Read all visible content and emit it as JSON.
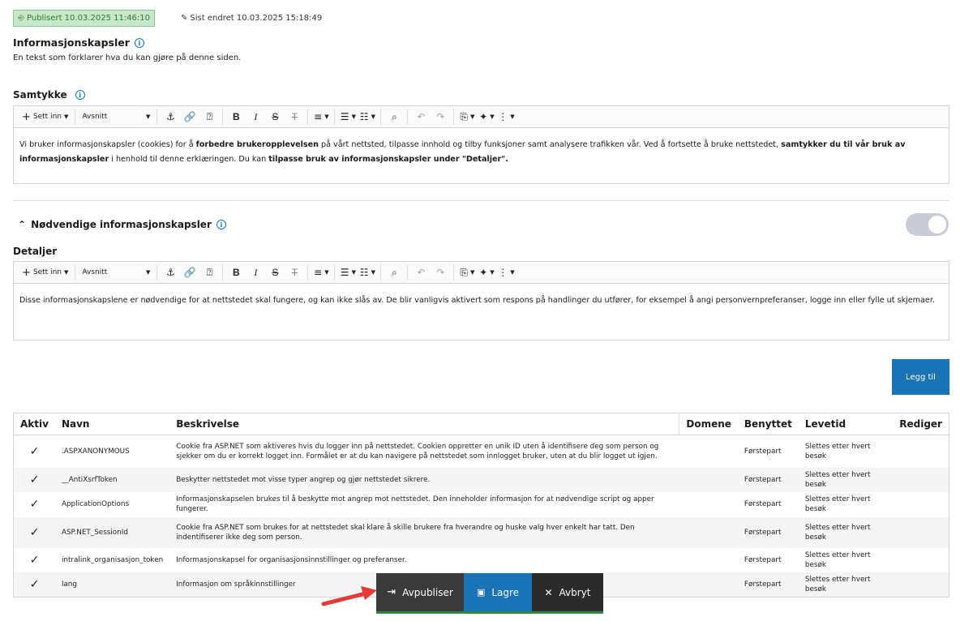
{
  "status": {
    "published": "Publisert 10.03.2025 11:46:10",
    "edited": "Sist endret 10.03.2025 15:18:49"
  },
  "page": {
    "title": "Informasjonskapsler",
    "description": "En tekst som forklarer hva du kan gjøre på denne siden."
  },
  "toolbar": {
    "insert": "Sett inn",
    "format": "Avsnitt"
  },
  "consent": {
    "label": "Samtykke",
    "text_1": "Vi bruker informasjonskapsler (cookies) for å ",
    "bold_1": "forbedre brukeropplevelsen",
    "text_2": " på vårt nettsted, tilpasse innhold og tilby funksjoner samt analysere trafikken vår. Ved å fortsette å bruke nettstedet, ",
    "bold_2": "samtykker du til vår bruk av informasjonskapsler",
    "text_3": " i henhold til denne erklæringen.  Du kan ",
    "bold_3": "tilpasse bruk av informasjonskapsler under \"Detaljer\"."
  },
  "necessary": {
    "title": "Nødvendige informasjonskapsler",
    "toggle_on": true,
    "details_label": "Detaljer",
    "details_text": "Disse informasjonskapslene er nødvendige for at nettstedet skal fungere, og kan ikke slås av. De blir vanligvis aktivert som respons på handlinger du utfører, for eksempel å angi personvernpreferanser, logge inn eller fylle ut skjemaer."
  },
  "add_button": "Legg til",
  "table": {
    "headers": [
      "Aktiv",
      "Navn",
      "Beskrivelse",
      "Domene",
      "Benyttet",
      "Levetid",
      "Rediger"
    ],
    "rows": [
      {
        "active": "✓",
        "name": ".ASPXANONYMOUS",
        "description": "Cookie fra ASP.NET som aktiveres hvis du logger inn på nettstedet. Cookien oppretter en unik ID uten å identifisere deg som person og sjekker om du er korrekt logget inn. Formålet er at du kan navigere på nettstedet som innlogget bruker, uten at du blir logget ut igjen.",
        "domain": "",
        "used": "Førstepart",
        "lifetime": "Slettes etter hvert besøk"
      },
      {
        "active": "✓",
        "name": "__AntiXsrfToken",
        "description": "Beskytter nettstedet mot visse typer angrep og gjør nettstedet sikrere.",
        "domain": "",
        "used": "Førstepart",
        "lifetime": "Slettes etter hvert besøk"
      },
      {
        "active": "✓",
        "name": "ApplicationOptions",
        "description": "Informasjonskapselen brukes til å beskytte mot angrep mot nettstedet. Den inneholder informasjon for at nødvendige script og apper fungerer.",
        "domain": "",
        "used": "Førstepart",
        "lifetime": "Slettes etter hvert besøk"
      },
      {
        "active": "✓",
        "name": "ASP.NET_SessionId",
        "description": "Cookie fra ASP.NET som brukes for at nettstedet skal klare å skille brukere fra hverandre og huske valg hver enkelt har tatt. Den indentifiserer ikke deg som person.",
        "domain": "",
        "used": "Førstepart",
        "lifetime": "Slettes etter hvert besøk"
      },
      {
        "active": "✓",
        "name": "intralink_organisasjon_token",
        "description": "Informasjonskapsel for organisasjonsinnstillinger og preferanser.",
        "domain": "",
        "used": "Førstepart",
        "lifetime": "Slettes etter hvert besøk"
      },
      {
        "active": "✓",
        "name": "lang",
        "description": "Informasjon om språkinnstillinger",
        "domain": "",
        "used": "Førstepart",
        "lifetime": "Slettes etter hvert besøk"
      }
    ]
  },
  "action_bar": {
    "unpublish": "Avpubliser",
    "save": "Lagre",
    "cancel": "Avbryt"
  },
  "colors": {
    "accent": "#1a73b5",
    "published_bg": "#c8e6c9",
    "published_text": "#2e7d32",
    "annotation_arrow": "#e53935"
  }
}
